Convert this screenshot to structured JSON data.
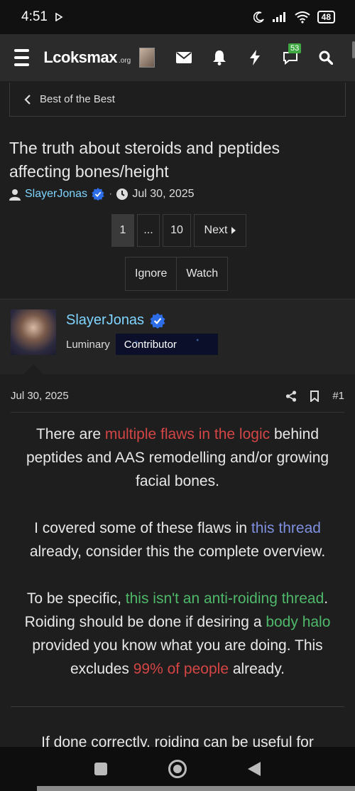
{
  "status": {
    "time": "4:51",
    "battery": "48"
  },
  "nav": {
    "logo_main": "Lcoksmax",
    "logo_tld": ".org",
    "notification_count": "53"
  },
  "breadcrumb": {
    "label": "Best of the Best"
  },
  "thread": {
    "title": "The truth about steroids and peptides affecting bones/height",
    "author": "SlayerJonas",
    "separator": "·",
    "date": "Jul 30, 2025"
  },
  "pagination": {
    "page1": "1",
    "ellipsis": "...",
    "page_last": "10",
    "next": "Next"
  },
  "actions": {
    "ignore": "Ignore",
    "watch": "Watch"
  },
  "user": {
    "name": "SlayerJonas",
    "role": "Luminary",
    "banner": "Contributor"
  },
  "post": {
    "date": "Jul 30, 2025",
    "number": "#1",
    "p1": {
      "a": "There are ",
      "b": "multiple flaws in the logic",
      "c": " behind peptides and AAS remodelling and/or growing facial bones."
    },
    "p2": {
      "a": "I covered some of these flaws in ",
      "b": "this thread",
      "c": " already, consider this the complete overview."
    },
    "p3": {
      "a": "To be specific, ",
      "b": "this isn't an anti-roiding thread",
      "c": ". Roiding should be done if desiring a ",
      "d": "body halo",
      "e": " provided you know what you are doing. This excludes ",
      "f": "99% of people",
      "g": " already."
    },
    "p4": "If done correctly, roiding can be useful for"
  },
  "colors": {
    "link": "#7fd5ff",
    "red": "#d44545",
    "blue": "#7f90e0",
    "green": "#4fb86a",
    "badge": "#3fa843"
  }
}
